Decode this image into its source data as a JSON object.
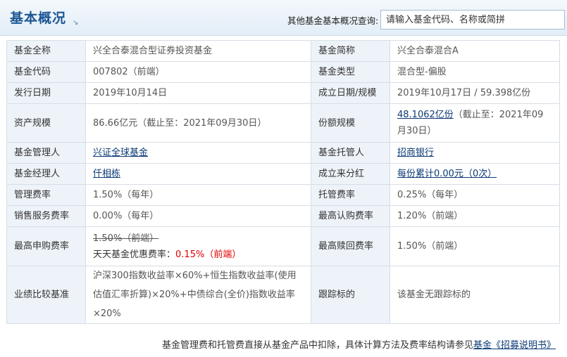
{
  "header": {
    "title": "基本概况",
    "title_arrow": "↘",
    "search_label": "其他基金基本概况查询:",
    "search_placeholder": "请输入基金代码、名称或简拼"
  },
  "rows": {
    "full_name": {
      "label": "基金全称",
      "value": "兴全合泰混合型证券投资基金"
    },
    "short_name": {
      "label": "基金简称",
      "value": "兴全合泰混合A"
    },
    "code": {
      "label": "基金代码",
      "value": "007802（前端）"
    },
    "type": {
      "label": "基金类型",
      "value": "混合型-偏股"
    },
    "issue_date": {
      "label": "发行日期",
      "value": "2019年10月14日"
    },
    "established": {
      "label": "成立日期/规模",
      "value": "2019年10月17日 / 59.398亿份"
    },
    "assets": {
      "label": "资产规模",
      "value": "86.66亿元（截止至：2021年09月30日）"
    },
    "shares": {
      "label": "份额规模",
      "link": "48.1062亿份",
      "rest": "（截止至：2021年09月30日）"
    },
    "manager_co": {
      "label": "基金管理人",
      "link": "兴证全球基金"
    },
    "custodian": {
      "label": "基金托管人",
      "link": "招商银行"
    },
    "manager": {
      "label": "基金经理人",
      "link": "仟相栋"
    },
    "dividend": {
      "label": "成立来分红",
      "link": "每份累计0.00元（0次）"
    },
    "mgmt_fee": {
      "label": "管理费率",
      "value": "1.50%（每年）"
    },
    "custody_fee": {
      "label": "托管费率",
      "value": "0.25%（每年）"
    },
    "sales_fee": {
      "label": "销售服务费率",
      "value": "0.00%（每年）"
    },
    "max_sub": {
      "label": "最高认购费率",
      "value": "1.20%（前端）"
    },
    "max_purchase": {
      "label": "最高申购费率",
      "original": "1.50%（前端）",
      "discount_label": "天天基金优惠费率：",
      "discount_value": "0.15%（前端）"
    },
    "max_redeem": {
      "label": "最高赎回费率",
      "value": "1.50%（前端）"
    },
    "benchmark": {
      "label": "业绩比较基准",
      "value": "沪深300指数收益率×60%+恒生指数收益率(使用估值汇率折算)×20%+中债综合(全价)指数收益率×20%"
    },
    "tracking": {
      "label": "跟踪标的",
      "value": "该基金无跟踪标的"
    }
  },
  "footer": {
    "text": "基金管理费和托管费直接从基金产品中扣除，具体计算方法及费率结构请参见",
    "link": "基金《招募说明书》"
  },
  "colors": {
    "title": "#1b5592",
    "label_bg": "#eef3f9",
    "border": "#d6dee6",
    "link": "#0b3a75",
    "discount": "#e00000"
  }
}
